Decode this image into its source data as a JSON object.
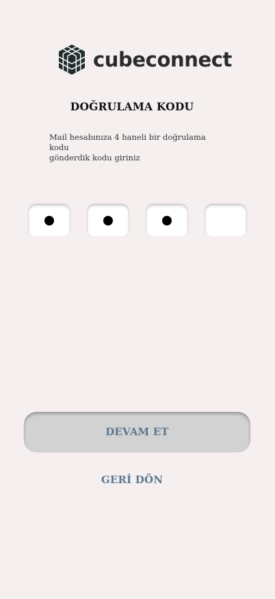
{
  "logo": {
    "text": "cubeconnect",
    "icon": "cube-grid-icon"
  },
  "verification": {
    "title": "DOĞRULAMA KODU",
    "subtitle_line1": "Mail hesabınıza 4 haneli bir doğrulama kodu",
    "subtitle_line2": "gönderdik kodu giriniz",
    "digits_filled": 3,
    "digits_total": 4
  },
  "actions": {
    "continue_label": "DEVAM ET",
    "back_label": "GERİ DÖN"
  },
  "colors": {
    "background": "#f5efef",
    "button_bg": "#d2d2d2",
    "accent_text": "#5c7890"
  }
}
